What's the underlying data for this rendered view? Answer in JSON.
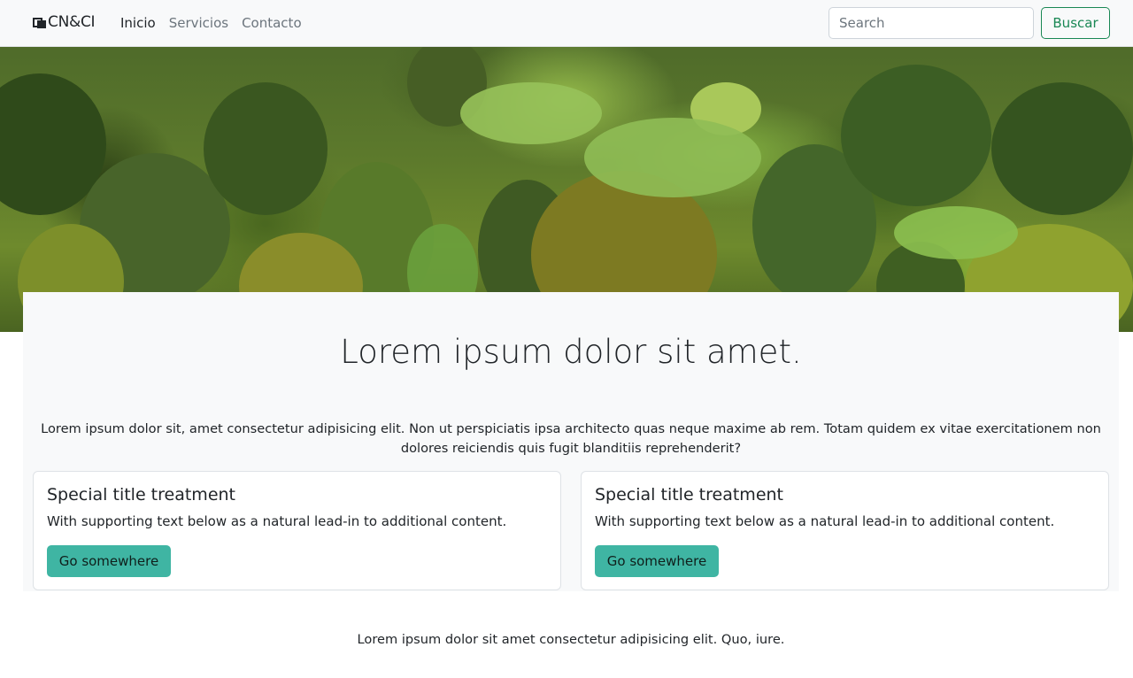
{
  "navbar": {
    "brand": "CN&CI",
    "links": [
      {
        "label": "Inicio",
        "active": true
      },
      {
        "label": "Servicios",
        "active": false
      },
      {
        "label": "Contacto",
        "active": false
      }
    ],
    "search_placeholder": "Search",
    "search_button": "Buscar"
  },
  "hero": {
    "image": "forest-hillside-image"
  },
  "main": {
    "title": "Lorem ipsum dolor sit amet.",
    "lead": "Lorem ipsum dolor sit, amet consectetur adipisicing elit. Non ut perspiciatis ipsa architecto quas neque maxime ab rem. Totam quidem ex vitae exercitationem non dolores reiciendis quis fugit blanditiis reprehenderit?",
    "cards": [
      {
        "title": "Special title treatment",
        "text": "With supporting text below as a natural lead-in to additional content.",
        "button": "Go somewhere"
      },
      {
        "title": "Special title treatment",
        "text": "With supporting text below as a natural lead-in to additional content.",
        "button": "Go somewhere"
      }
    ]
  },
  "footer": {
    "text": "Lorem ipsum dolor sit amet consectetur adipisicing elit. Quo, iure."
  },
  "colors": {
    "navbar_bg": "#f8f9fa",
    "search_button": "#198754",
    "card_button": "#3fb5a3",
    "panel_bg": "#f8f9fa"
  }
}
